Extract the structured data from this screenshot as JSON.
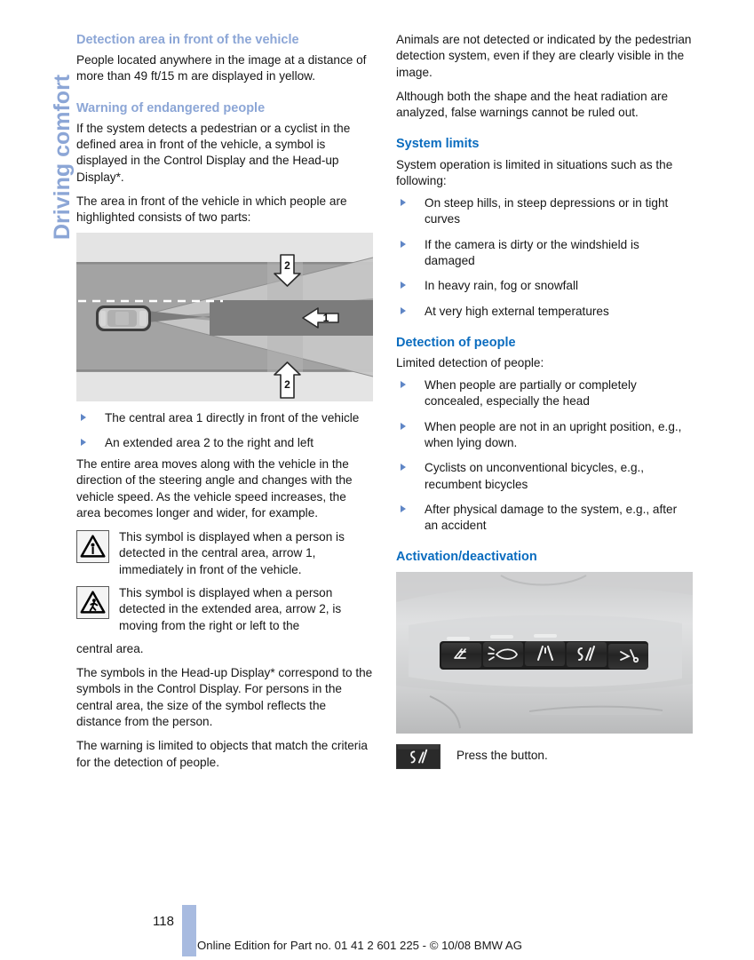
{
  "chapter": {
    "tab_label": "Driving comfort"
  },
  "left_column": {
    "heading_detection_area": "Detection area in front of the vehicle",
    "para_detection_area": "People located anywhere in the image at a distance of more than 49 ft/15 m are displayed in yellow.",
    "heading_warning": "Warning of endangered people",
    "para_warning_1": "If the system detects a pedestrian or a cyclist in the defined area in front of the vehicle, a symbol is displayed in the Control Display and the Head-up Display*.",
    "para_warning_2": "The area in front of the vehicle in which people are highlighted consists of two parts:",
    "diagram": {
      "name": "detection-area-diagram",
      "callout_center": "1",
      "callout_extended_top": "2",
      "callout_extended_bottom": "2"
    },
    "area_bullets": [
      "The central area 1 directly in front of the vehicle",
      "An extended area 2 to the right and left"
    ],
    "para_area_moves": "The entire area moves along with the vehicle in the direction of the steering angle and changes with the vehicle speed. As the vehicle speed increases, the area becomes longer and wider, for example.",
    "symbol_central": {
      "icon": "pedestrian-warning-triangle-icon",
      "text": "This symbol is displayed when a person is detected in the central area, arrow 1, immediately in front of the vehicle."
    },
    "symbol_extended": {
      "icon": "pedestrian-crossing-warning-triangle-icon",
      "text": "This symbol is displayed when a person detected in the extended area, arrow 2, is moving from the right or left to the"
    },
    "symbol_extended_continuation": "central area.",
    "para_headup": "The symbols in the Head-up Display* correspond to the symbols in the Control Display. For persons in the central area, the size of the symbol reflects the distance from the person.",
    "para_warning_limited": "The warning is limited to objects that match the criteria for the detection of people."
  },
  "right_column": {
    "para_animals": "Animals are not detected or indicated by the pedestrian detection system, even if they are clearly visible in the image.",
    "para_shape_heat": "Although both the shape and the heat radiation are analyzed, false warnings cannot be ruled out.",
    "heading_system_limits": "System limits",
    "para_system_limits": "System operation is limited in situations such as the following:",
    "system_limits_bullets": [
      "On steep hills, in steep depressions or in tight curves",
      "If the camera is dirty or the windshield is damaged",
      "In heavy rain, fog or snowfall",
      "At very high external temperatures"
    ],
    "heading_detection_people": "Detection of people",
    "para_detection_people": "Limited detection of people:",
    "detection_people_bullets": [
      "When people are partially or completely concealed, especially the head",
      "When people are not in an upright position, e.g., when lying down.",
      "Cyclists on unconventional bicycles, e.g., recumbent bicycles",
      "After physical damage to the system, e.g., after an accident"
    ],
    "heading_activation": "Activation/deactivation",
    "console_photo": {
      "name": "center-console-button-panel-photo",
      "buttons": [
        "head-up-display-button",
        "washer-nozzle-button",
        "lane-departure-warning-button",
        "night-vision-pedestrian-button",
        "seat-adjust-button"
      ]
    },
    "press_button": {
      "icon": "night-vision-pedestrian-button-icon",
      "label": "Press the button."
    }
  },
  "footer": {
    "page_number": "118",
    "edition_text": "Online Edition for Part no. 01 41 2 601 225 - © 10/08 BMW AG"
  },
  "colors": {
    "tab_blue": "#8ca6d6",
    "heading_blue_light": "#8ca6d6",
    "heading_blue_strong": "#0a6cbf",
    "bullet_blue": "#5f86c6",
    "footer_bar": "#a8bbe0"
  }
}
